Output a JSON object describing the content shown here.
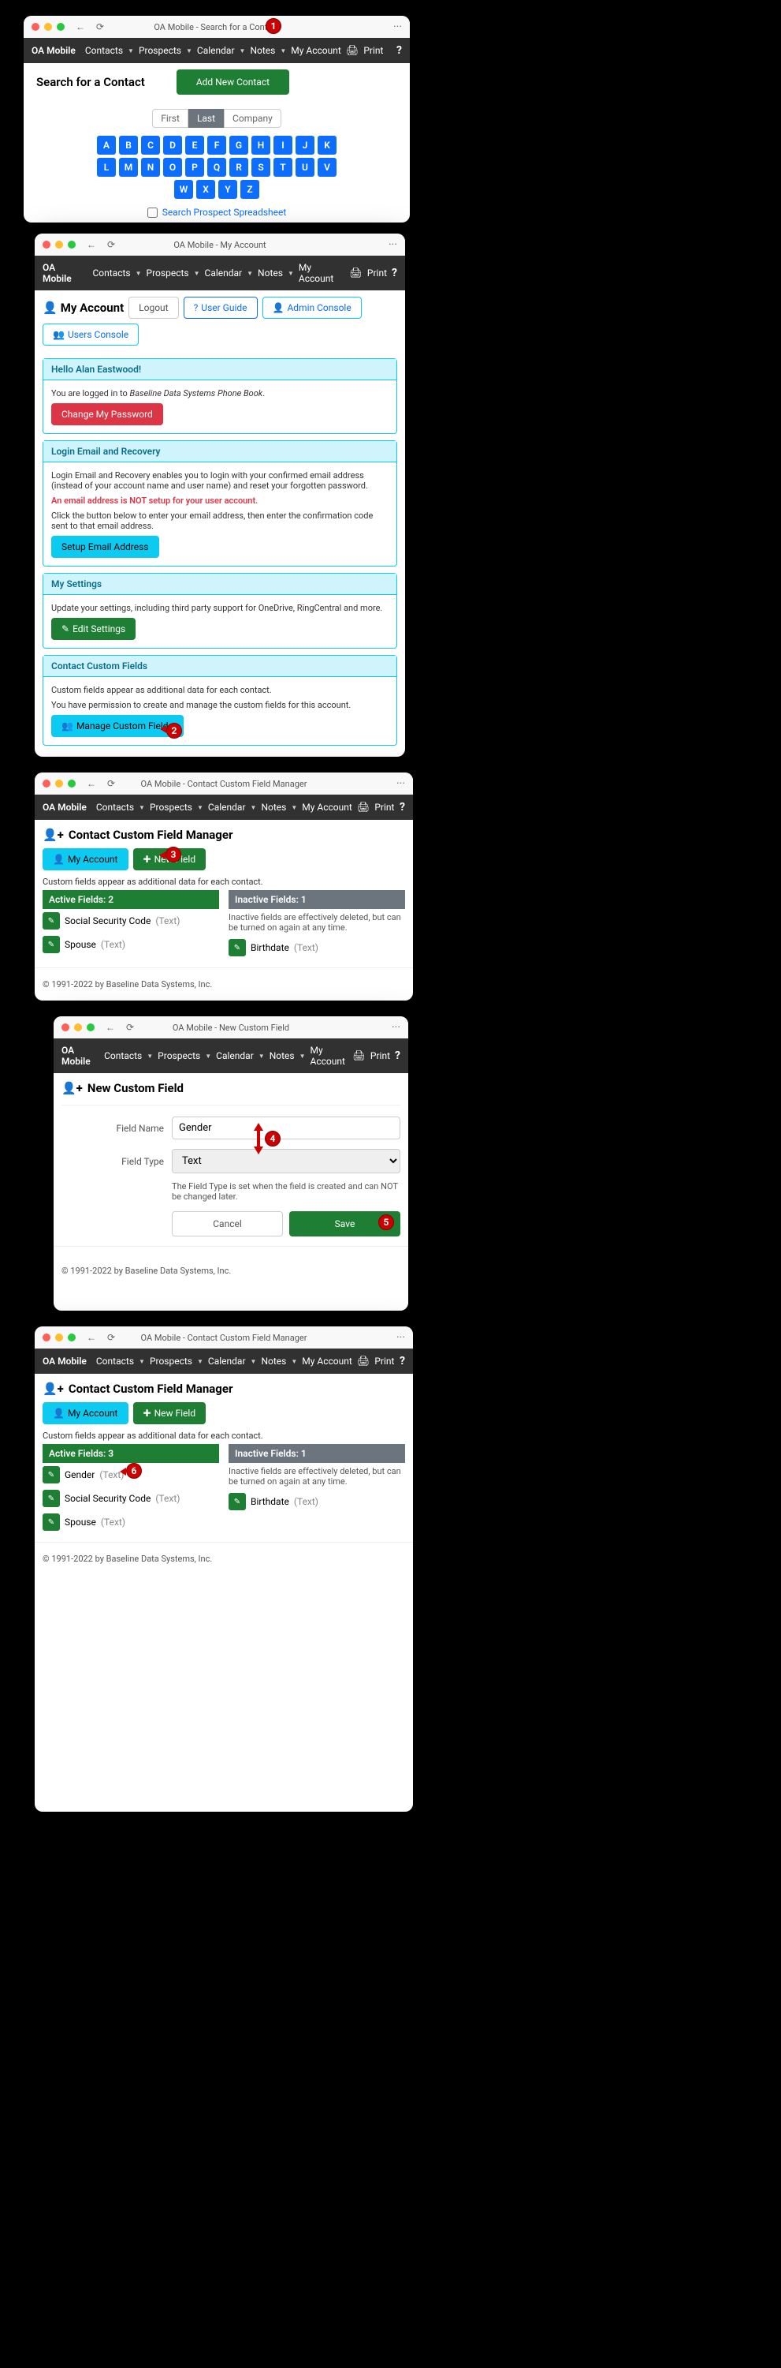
{
  "nav": {
    "brand": "OA Mobile",
    "contacts": "Contacts",
    "prospects": "Prospects",
    "calendar": "Calendar",
    "notes": "Notes",
    "myaccount": "My Account",
    "print": "Print",
    "help": "?"
  },
  "titlebars": {
    "back": "←",
    "reload": "⟳",
    "more": "···"
  },
  "screen1": {
    "title": "OA Mobile - Search for a Contact",
    "heading": "Search for a Contact",
    "addNew": "Add New Contact",
    "seg": {
      "first": "First",
      "last": "Last",
      "company": "Company"
    },
    "az1": [
      "A",
      "B",
      "C",
      "D",
      "E",
      "F",
      "G",
      "H",
      "I",
      "J",
      "K"
    ],
    "az2": [
      "L",
      "M",
      "N",
      "O",
      "P",
      "Q",
      "R",
      "S",
      "T",
      "U",
      "V"
    ],
    "az3": [
      "W",
      "X",
      "Y",
      "Z"
    ],
    "spreadsheet": "Search Prospect Spreadsheet"
  },
  "screen2": {
    "title": "OA Mobile - My Account",
    "heading": "My Account",
    "logout": "Logout",
    "userGuide": "User Guide",
    "adminConsole": "Admin Console",
    "usersConsole": "Users Console",
    "hello": "Hello Alan Eastwood!",
    "loggedInPrefix": "You are logged in to ",
    "loggedInSuffix": "Baseline Data Systems Phone Book",
    "changePw": "Change My Password",
    "loginRecovery": {
      "heading": "Login Email and Recovery",
      "text1": "Login Email and Recovery enables you to login with your confirmed email address (instead of your account name and user name) and reset your forgotten password.",
      "warning": "An email address is NOT setup for your user account.",
      "text2": "Click the button below to enter your email address, then enter the confirmation code sent to that email address.",
      "button": "Setup Email Address"
    },
    "settings": {
      "heading": "My Settings",
      "text": "Update your settings, including third party support for OneDrive, RingCentral and more.",
      "button": "Edit Settings"
    },
    "custom": {
      "heading": "Contact Custom Fields",
      "text1": "Custom fields appear as additional data for each contact.",
      "text2": "You have permission to create and manage the custom fields for this account.",
      "button": "Manage Custom Fields"
    }
  },
  "screen3": {
    "title": "OA Mobile - Contact Custom Field Manager",
    "heading": "Contact Custom Field Manager",
    "myAccount": "My Account",
    "newField": "New Field",
    "subtext": "Custom fields appear as additional data for each contact.",
    "activeHeader": "Active Fields: 2",
    "inactiveHeader": "Inactive Fields: 1",
    "inactiveText": "Inactive fields are effectively deleted, but can be turned on again at any time.",
    "active": [
      {
        "name": "Social Security Code",
        "type": "(Text)"
      },
      {
        "name": "Spouse",
        "type": "(Text)"
      }
    ],
    "inactive": [
      {
        "name": "Birthdate",
        "type": "(Text)"
      }
    ]
  },
  "screen4": {
    "title": "OA Mobile - New Custom Field",
    "heading": "New Custom Field",
    "fieldName": "Field Name",
    "fieldNameValue": "Gender",
    "fieldType": "Field Type",
    "fieldTypeValue": "Text",
    "note": "The Field Type is set when the field is created and can NOT be changed later.",
    "cancel": "Cancel",
    "save": "Save"
  },
  "screen5": {
    "title": "OA Mobile - Contact Custom Field Manager",
    "heading": "Contact Custom Field Manager",
    "myAccount": "My Account",
    "newField": "New Field",
    "subtext": "Custom fields appear as additional data for each contact.",
    "activeHeader": "Active Fields: 3",
    "inactiveHeader": "Inactive Fields: 1",
    "inactiveText": "Inactive fields are effectively deleted, but can be turned on again at any time.",
    "active": [
      {
        "name": "Gender",
        "type": "(Text)"
      },
      {
        "name": "Social Security Code",
        "type": "(Text)"
      },
      {
        "name": "Spouse",
        "type": "(Text)"
      }
    ],
    "inactive": [
      {
        "name": "Birthdate",
        "type": "(Text)"
      }
    ]
  },
  "footer": "© 1991-2022 by Baseline Data Systems, Inc.",
  "markers": {
    "m1": "1",
    "m2": "2",
    "m3": "3",
    "m4": "4",
    "m5": "5",
    "m6": "6"
  }
}
